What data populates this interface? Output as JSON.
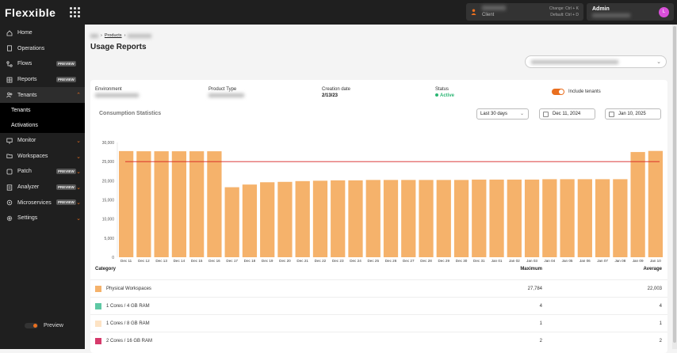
{
  "brand": "Flexxible",
  "client": {
    "label": "Client",
    "shortcuts": [
      "Change: Ctrl + K",
      "Default: Ctrl + D"
    ]
  },
  "admin": {
    "label": "Admin",
    "avatar": "L"
  },
  "sidebar": {
    "items": [
      {
        "label": "Home",
        "icon": "home-icon"
      },
      {
        "label": "Operations",
        "icon": "document-icon"
      },
      {
        "label": "Flows",
        "icon": "flow-icon",
        "badge": "PREVIEW"
      },
      {
        "label": "Reports",
        "icon": "report-icon",
        "badge": "PREVIEW"
      },
      {
        "label": "Tenants",
        "icon": "tenants-icon",
        "expanded": true
      },
      {
        "label": "Monitor",
        "icon": "monitor-icon"
      },
      {
        "label": "Workspaces",
        "icon": "folder-icon"
      },
      {
        "label": "Patch",
        "icon": "patch-icon",
        "badge": "PREVIEW"
      },
      {
        "label": "Analyzer",
        "icon": "analyzer-icon",
        "badge": "PREVIEW"
      },
      {
        "label": "Microservices",
        "icon": "microservices-icon",
        "badge": "PREVIEW"
      },
      {
        "label": "Settings",
        "icon": "gear-icon"
      }
    ],
    "subitems": [
      "Tenants",
      "Activations"
    ],
    "preview_label": "Preview"
  },
  "breadcrumb": {
    "current": "Products"
  },
  "page": {
    "title": "Usage Reports"
  },
  "info": {
    "environment_label": "Environment",
    "product_type_label": "Product Type",
    "creation_date_label": "Creation date",
    "creation_date": "2/13/23",
    "status_label": "Status",
    "status": "Active",
    "include_tenants_label": "Include tenants"
  },
  "consumption": {
    "title": "Consumption Statistics",
    "range": "Last 30 days",
    "start": "Dec 11, 2024",
    "end": "Jan 10, 2025"
  },
  "colors": {
    "accent": "#e96f1f",
    "bar": "#f5b26b",
    "line": "#d62020"
  },
  "chart_data": {
    "type": "bar",
    "categories": [
      "Dec 11",
      "Dec 12",
      "Dec 13",
      "Dec 14",
      "Dec 15",
      "Dec 16",
      "Dec 17",
      "Dec 18",
      "Dec 19",
      "Dec 20",
      "Dec 21",
      "Dec 22",
      "Dec 23",
      "Dec 24",
      "Dec 25",
      "Dec 26",
      "Dec 27",
      "Dec 28",
      "Dec 29",
      "Dec 30",
      "Dec 31",
      "Jan 01",
      "Jan 02",
      "Jan 03",
      "Jan 04",
      "Jan 05",
      "Jan 06",
      "Jan 07",
      "Jan 08",
      "Jan 09",
      "Jan 10"
    ],
    "values": [
      27750,
      27700,
      27700,
      27700,
      27700,
      27700,
      18300,
      19000,
      19600,
      19700,
      19900,
      20000,
      20100,
      20100,
      20200,
      20200,
      20200,
      20200,
      20200,
      20200,
      20300,
      20300,
      20300,
      20300,
      20400,
      20400,
      20400,
      20400,
      20400,
      27500,
      27784
    ],
    "reference_line": 25000,
    "y_ticks": [
      "0",
      "5,000",
      "10,000",
      "15,000",
      "20,000",
      "25,000",
      "30,000"
    ],
    "ylim": [
      0,
      30000
    ],
    "grid": false
  },
  "table": {
    "headers": {
      "category": "Category",
      "maximum": "Maximum",
      "average": "Average"
    },
    "rows": [
      {
        "name": "Physical Workspaces",
        "max": "27,784",
        "avg": "22,003",
        "color": "#f5b26b"
      },
      {
        "name": "1 Cores / 4 GB RAM",
        "max": "4",
        "avg": "4",
        "color": "#5ec8a4"
      },
      {
        "name": "1 Cores / 8 GB RAM",
        "max": "1",
        "avg": "1",
        "color": "#fde3c4"
      },
      {
        "name": "2 Cores / 16 GB RAM",
        "max": "2",
        "avg": "2",
        "color": "#d63a6b"
      }
    ]
  }
}
